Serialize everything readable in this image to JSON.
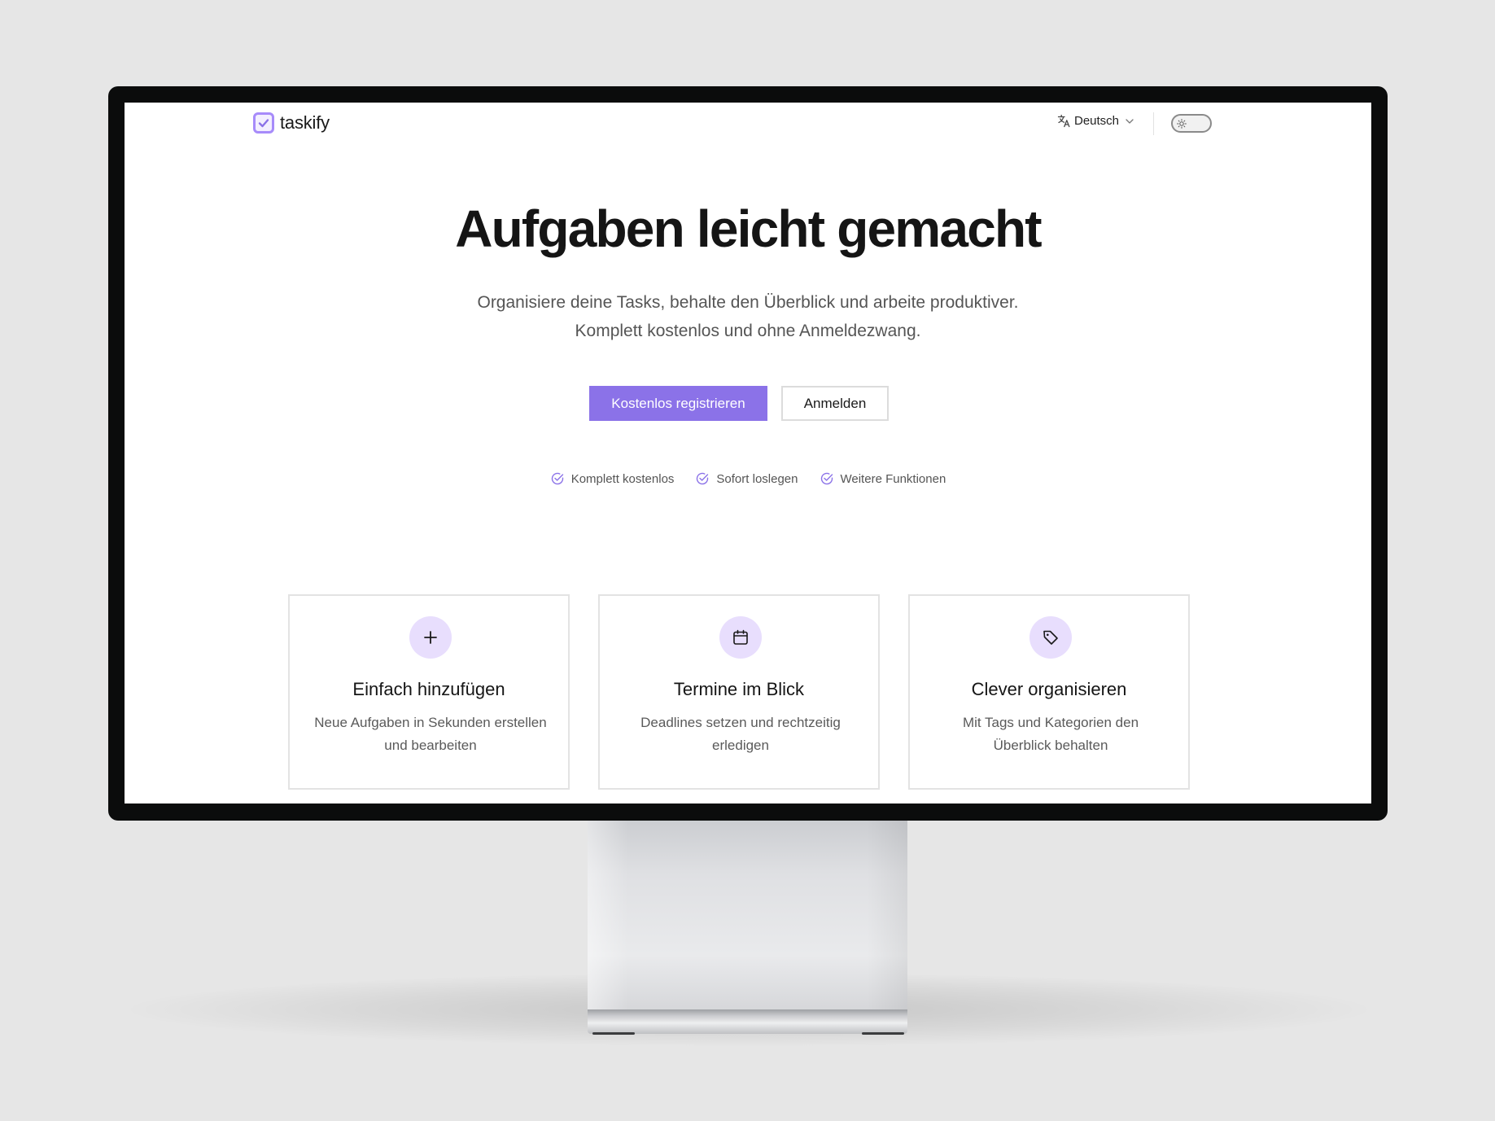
{
  "colors": {
    "accent": "#8b72e8",
    "accent_light": "#e8defd",
    "logo_border": "#a78bfa"
  },
  "header": {
    "brand": "taskify",
    "logo_icon": "checkbox-icon",
    "language": {
      "icon": "translate-icon",
      "label": "Deutsch",
      "chevron": "chevron-down-icon"
    },
    "theme_toggle": {
      "icon": "sun-icon",
      "state": "light"
    }
  },
  "hero": {
    "title": "Aufgaben leicht gemacht",
    "subtitle_lines": [
      "Organisiere deine Tasks, behalte den Überblick und arbeite produktiver.",
      "Komplett kostenlos und ohne Anmeldezwang."
    ],
    "primary_button": "Kostenlos registrieren",
    "secondary_button": "Anmelden",
    "highlights": [
      {
        "icon": "check-circle-icon",
        "label": "Komplett kostenlos"
      },
      {
        "icon": "check-circle-icon",
        "label": "Sofort loslegen"
      },
      {
        "icon": "check-circle-icon",
        "label": "Weitere Funktionen"
      }
    ]
  },
  "cards": [
    {
      "icon": "plus-icon",
      "title": "Einfach hinzufügen",
      "desc_lines": [
        "Neue Aufgaben in Sekunden erstellen",
        "und bearbeiten"
      ]
    },
    {
      "icon": "calendar-icon",
      "title": "Termine im Blick",
      "desc_lines": [
        "Deadlines setzen und rechtzeitig",
        "erledigen"
      ]
    },
    {
      "icon": "tag-icon",
      "title": "Clever organisieren",
      "desc_lines": [
        "Mit Tags und Kategorien den",
        "Überblick behalten"
      ]
    }
  ]
}
